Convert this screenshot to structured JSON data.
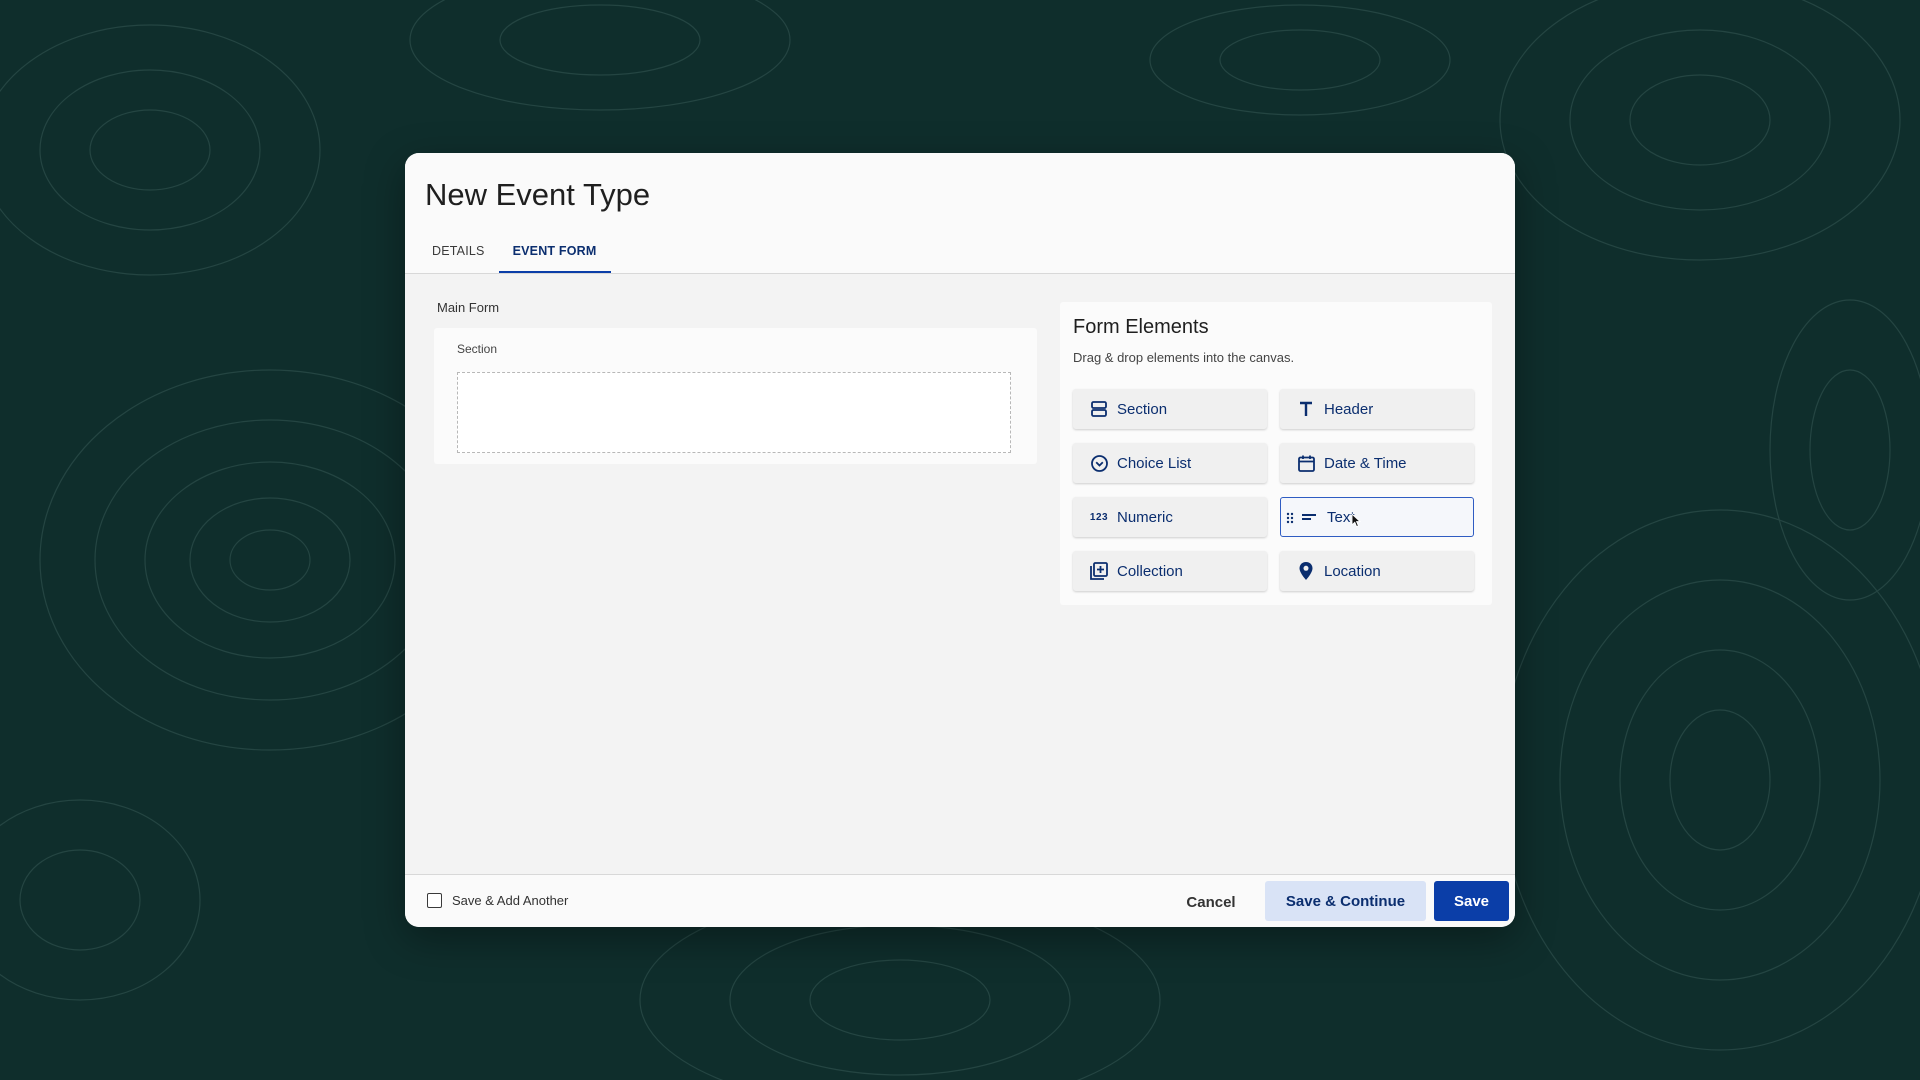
{
  "dialog": {
    "title": "New Event Type",
    "tabs": [
      {
        "label": "DETAILS",
        "active": false
      },
      {
        "label": "EVENT FORM",
        "active": true
      }
    ]
  },
  "canvas": {
    "main_form_label": "Main Form",
    "section_label": "Section"
  },
  "form_elements": {
    "title": "Form Elements",
    "subtitle": "Drag & drop elements into the canvas.",
    "items": [
      {
        "label": "Section",
        "icon": "section-icon"
      },
      {
        "label": "Header",
        "icon": "header-icon"
      },
      {
        "label": "Choice List",
        "icon": "choice-list-icon"
      },
      {
        "label": "Date & Time",
        "icon": "calendar-icon"
      },
      {
        "label": "Numeric",
        "icon": "numeric-icon",
        "glyph": "123"
      },
      {
        "label": "Text",
        "icon": "text-icon",
        "hovered": true
      },
      {
        "label": "Collection",
        "icon": "collection-icon"
      },
      {
        "label": "Location",
        "icon": "location-pin-icon"
      }
    ]
  },
  "footer": {
    "save_add_another_label": "Save & Add Another",
    "save_add_another_checked": false,
    "cancel_label": "Cancel",
    "save_continue_label": "Save & Continue",
    "save_label": "Save"
  },
  "colors": {
    "background": "#0f2e2c",
    "primary": "#0b3ea8",
    "primary_text": "#0b2e6f",
    "secondary_button": "#d9e3f6"
  }
}
